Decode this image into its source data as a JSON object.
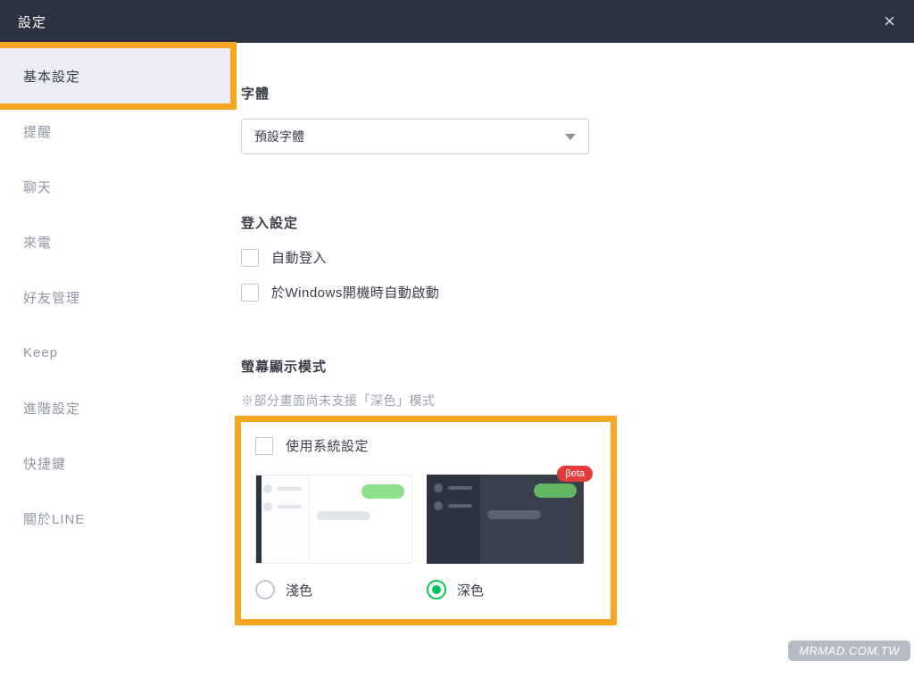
{
  "titlebar": {
    "title": "設定"
  },
  "sidebar": {
    "items": [
      {
        "label": "基本設定",
        "active": true
      },
      {
        "label": "提醒"
      },
      {
        "label": "聊天"
      },
      {
        "label": "來電"
      },
      {
        "label": "好友管理"
      },
      {
        "label": "Keep"
      },
      {
        "label": "進階設定"
      },
      {
        "label": "快捷鍵"
      },
      {
        "label": "關於LINE"
      }
    ]
  },
  "font": {
    "title": "字體",
    "selected": "預設字體"
  },
  "login": {
    "title": "登入設定",
    "auto_login": "自動登入",
    "start_on_boot": "於Windows開機時自動啟動"
  },
  "theme": {
    "title": "螢幕顯示模式",
    "hint": "※部分畫面尚未支援「深色」模式",
    "use_system": "使用系統設定",
    "light_label": "淺色",
    "dark_label": "深色",
    "beta": "βeta",
    "selected": "dark"
  },
  "watermark": "MRMAD.COM.TW"
}
